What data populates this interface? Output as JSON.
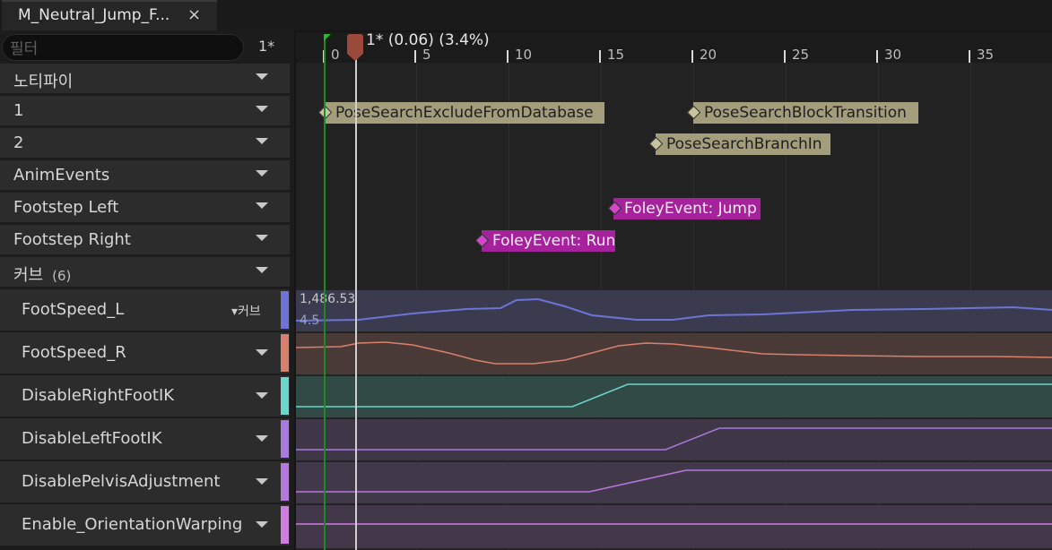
{
  "tab": {
    "title": "M_Neutral_Jump_F...",
    "close_glyph": "×"
  },
  "filter": {
    "placeholder": "필터",
    "frame_count": "1*"
  },
  "tracks": [
    {
      "label": "노티파이"
    },
    {
      "label": "1"
    },
    {
      "label": "2"
    },
    {
      "label": "AnimEvents"
    },
    {
      "label": "Footstep Left"
    },
    {
      "label": "Footstep Right"
    },
    {
      "label": "커브",
      "count": "(6)"
    }
  ],
  "curves": [
    {
      "label": "FootSpeed_L",
      "color": "#6e73d8",
      "menu": "▾커브"
    },
    {
      "label": "FootSpeed_R",
      "color": "#d9806c"
    },
    {
      "label": "DisableRightFootIK",
      "color": "#6bd6cc"
    },
    {
      "label": "DisableLeftFootIK",
      "color": "#a879e0"
    },
    {
      "label": "DisablePelvisAdjustment",
      "color": "#b877df"
    },
    {
      "label": "Enable_OrientationWarping",
      "color": "#d27be2"
    }
  ],
  "ruler": {
    "ticks": [
      "0",
      "5",
      "10",
      "15",
      "20",
      "25",
      "30",
      "35"
    ],
    "playhead_text": "1* (0.06) (3.4%)"
  },
  "notifies": [
    {
      "text": "PoseSearchExcludeFromDatabase",
      "track": "1"
    },
    {
      "text": "PoseSearchBlockTransition",
      "track": "1"
    },
    {
      "text": "PoseSearchBranchIn",
      "track": "2"
    },
    {
      "text": "FoleyEvent: Jump",
      "track": "Footstep Left"
    },
    {
      "text": "FoleyEvent: Run",
      "track": "Footstep Right"
    }
  ],
  "curve_values": {
    "max": "1,486.53",
    "min": "4.5"
  },
  "colors": {
    "accent_green": "#2cb52c",
    "playhead": "#9c4a3c",
    "notify_gray": "#a39d7c",
    "notify_magenta": "#a6219c"
  }
}
